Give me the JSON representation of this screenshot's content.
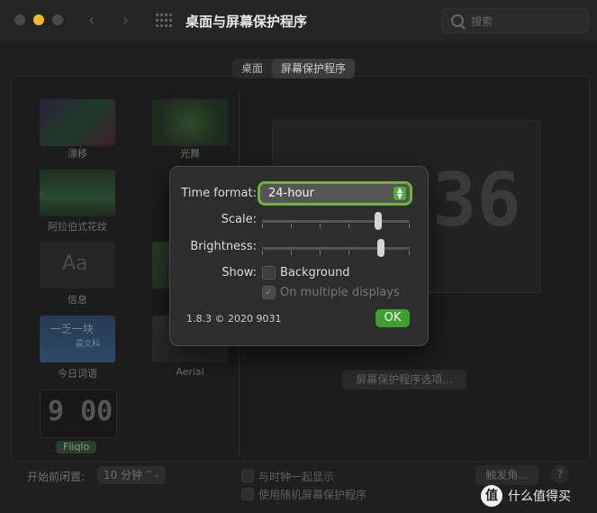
{
  "window": {
    "title": "桌面与屏幕保护程序",
    "search_placeholder": "搜索"
  },
  "tabs": [
    {
      "label": "桌面",
      "selected": false
    },
    {
      "label": "屏幕保护程序",
      "selected": true
    }
  ],
  "screensavers": [
    {
      "name": "漂移",
      "icon": "drift-thumbnail"
    },
    {
      "name": "光舞",
      "icon": "flurry-thumbnail"
    },
    {
      "name": "阿拉伯式花纹",
      "icon": "arabesque-thumbnail"
    },
    {
      "name": "信息",
      "icon": "message-thumbnail"
    },
    {
      "name": "今日词语",
      "icon": "word-of-the-day-thumbnail"
    },
    {
      "name": "Aerial",
      "icon": "aerial-thumbnail"
    },
    {
      "name": "Fliqlo",
      "icon": "fliqlo-thumbnail",
      "selected": true
    }
  ],
  "thumb_texts": {
    "message": "Aa",
    "word_line1": "一乏一块",
    "word_line2": "晨文科",
    "fliqlo_clock": "9 00"
  },
  "preview": {
    "clock_digits": "36"
  },
  "screensaver_options_label": "屏幕保护程序选项...",
  "bottom": {
    "start_label": "开始前闲置:",
    "start_value": "10 分钟",
    "show_with_clock": "与时钟一起显示",
    "use_random": "使用随机屏幕保护程序",
    "hot_corners": "触发角...",
    "help": "?"
  },
  "watermark": {
    "badge": "值",
    "text": "什么值得买"
  },
  "dialog": {
    "time_format_label": "Time format:",
    "time_format_value": "24-hour",
    "scale_label": "Scale:",
    "scale_level": 0.8,
    "brightness_label": "Brightness:",
    "brightness_level": 0.82,
    "show_label": "Show:",
    "background_label": "Background",
    "background_checked": false,
    "multi_display_label": "On multiple displays",
    "multi_display_checked": true,
    "version": "1.8.3 © 2020 9031",
    "ok_label": "OK"
  },
  "colors": {
    "accent_green": "#3e9f2e",
    "traffic_yellow": "#f5b82e"
  }
}
